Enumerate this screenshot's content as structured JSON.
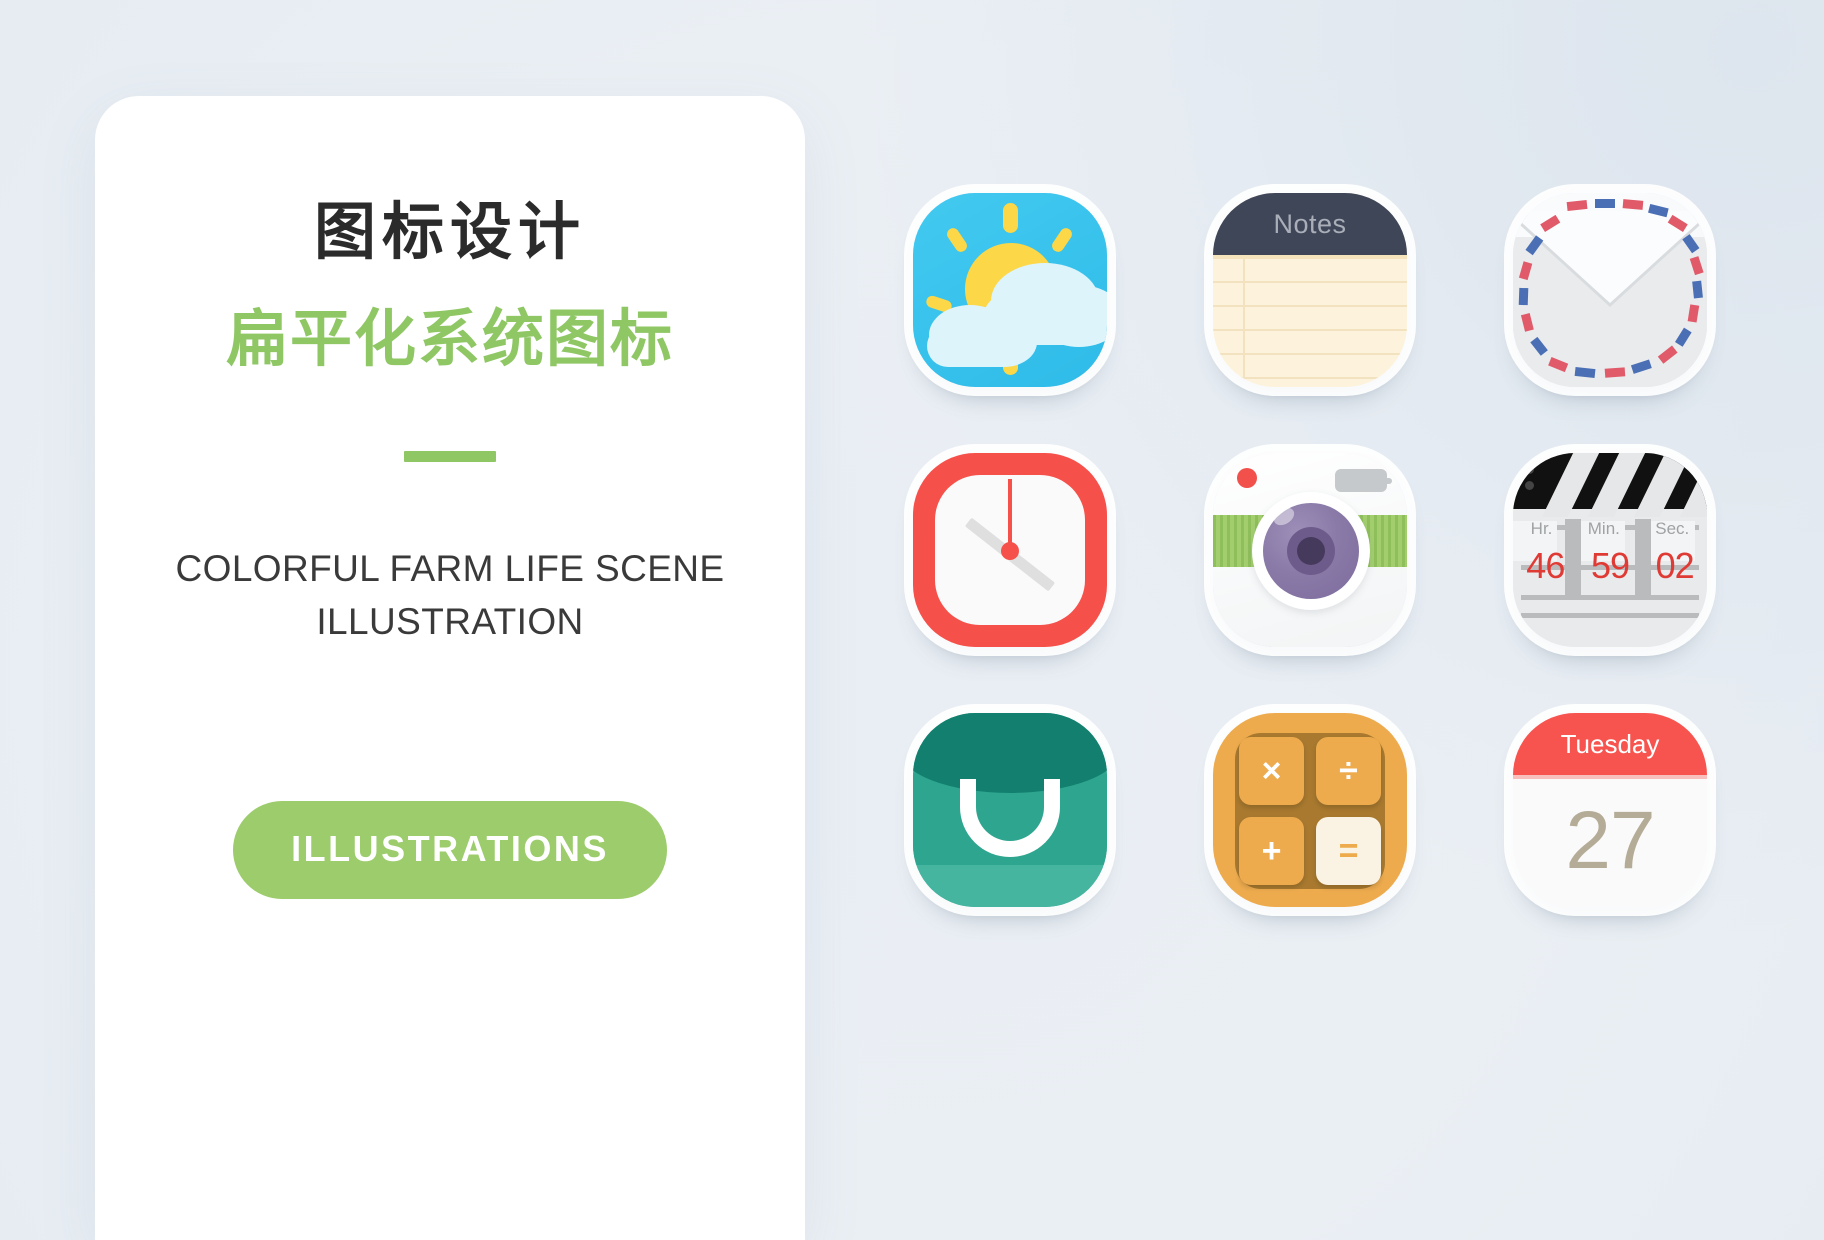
{
  "page": {
    "background_color": "#eaeff4"
  },
  "left_card": {
    "title_cn": "图标设计",
    "subtitle_cn": "扁平化系统图标",
    "divider_color": "#8fc765",
    "tagline": "COLORFUL FARM LIFE SCENE ILLUSTRATION",
    "cta_label": "ILLUSTRATIONS",
    "cta_color": "#9ccc6b"
  },
  "icons": [
    {
      "id": "weather",
      "name": "weather-icon",
      "label": "Weather",
      "background": "#3ac4ee",
      "sun_color": "#fcd748",
      "cloud_color": "#ddf4fb"
    },
    {
      "id": "notes",
      "name": "notes-icon",
      "label": "Notes",
      "header_text": "Notes",
      "header_color": "#3f4658",
      "paper_color": "#fdf3dd",
      "rule_color": "#f3e2bf"
    },
    {
      "id": "mail",
      "name": "mail-icon",
      "label": "Mail",
      "background": "#f6f8f9",
      "airmail_red": "#e05a6a",
      "airmail_blue": "#4a6fb5"
    },
    {
      "id": "clock",
      "name": "clock-icon",
      "label": "Clock",
      "frame_color": "#f6504a",
      "face_color": "#fafafa",
      "hand_color": "#dfdfdf"
    },
    {
      "id": "camera",
      "name": "camera-icon",
      "label": "Camera",
      "body_color": "#ffffff",
      "band_color": "#8fbf5a",
      "lens_color": "#8a7aa8",
      "shutter_color": "#f2504a"
    },
    {
      "id": "clapper",
      "name": "clapperboard-timer-icon",
      "label": "Video Timer",
      "top_color": "#111111",
      "body_color": "#e9eaec",
      "digit_color": "#e03a35",
      "units": [
        "Hr.",
        "Min.",
        "Sec."
      ],
      "values": [
        "46",
        "59",
        "02"
      ]
    },
    {
      "id": "bag",
      "name": "shopping-bag-icon",
      "label": "Store",
      "top_color": "#13806f",
      "body_color": "#2ea58f",
      "base_color": "#45b5a0",
      "handle_color": "#ffffff"
    },
    {
      "id": "calculator",
      "name": "calculator-icon",
      "label": "Calculator",
      "frame_color": "#edab4e",
      "plate_color": "#a8792f",
      "keys": [
        "×",
        "÷",
        "+",
        "="
      ],
      "equals_key_background": "#faf2e2"
    },
    {
      "id": "calendar",
      "name": "calendar-icon",
      "label": "Calendar",
      "weekday": "Tuesday",
      "date": "27",
      "header_color": "#f7544f",
      "date_color": "#b4ac97"
    }
  ]
}
